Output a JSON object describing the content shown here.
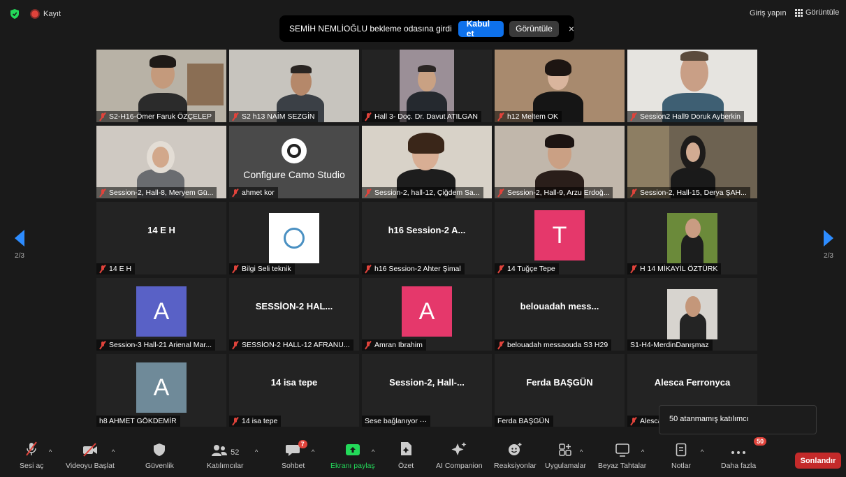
{
  "top": {
    "recording_label": "Kayıt",
    "signin_label": "Giriş yapın",
    "view_label": "Görüntüle"
  },
  "notification": {
    "text": "SEMİH NEMLİOĞLU bekleme odasına girdi",
    "accept_label": "Kabul et",
    "show_label": "Görüntüle",
    "close": "×"
  },
  "pager": {
    "left": "2/3",
    "right": "2/3"
  },
  "tiles": [
    {
      "name": "S2-H16-Ömer Faruk ÖZÇELEP"
    },
    {
      "name": "S2 h13 NAİM SEZGİN"
    },
    {
      "name": "Hall 3- Doç. Dr. Davut ATILGAN"
    },
    {
      "name": "h12 Meltem OK"
    },
    {
      "name": "Session2 Hall9 Doruk Ayberkin"
    },
    {
      "name": "Session-2, Hall-8, Meryem Gü..."
    },
    {
      "name": "ahmet kor",
      "display": "Configure Camo Studio"
    },
    {
      "name": "Session-2, hall-12, Çiğdem Sa..."
    },
    {
      "name": "Session-2, Hall-9, Arzu Erdoğ..."
    },
    {
      "name": "Session-2, Hall-15, Derya ŞAH..."
    },
    {
      "name": "14 E H",
      "display": "14 E H"
    },
    {
      "name": "Bilgi Seli teknik"
    },
    {
      "name": "h16 Session-2 Ahter Şimal",
      "display": "h16 Session-2 A..."
    },
    {
      "name": "14 Tuğçe Tepe",
      "avatar": "T"
    },
    {
      "name": "H 14  MİKAYİL ÖZTÜRK"
    },
    {
      "name": "Session-3 Hall-21 Arienal Mar...",
      "avatar": "A"
    },
    {
      "name": "SESSİON-2 HALL-12 AFRANU...",
      "display": "SESSİON-2  HAL..."
    },
    {
      "name": "Amran Ibrahim",
      "avatar": "A"
    },
    {
      "name": "belouadah messaouda S3  H29",
      "display": "belouadah  mess..."
    },
    {
      "name": "S1-H4-MerdinDanışmaz"
    },
    {
      "name": "h8 AHMET GÖKDEMİR",
      "avatar": "A"
    },
    {
      "name": "14 isa tepe",
      "display": "14 isa tepe"
    },
    {
      "name": "Sese bağlanıyor ···",
      "display": "Session-2,   Hall-..."
    },
    {
      "name": "Ferda BAŞGÜN",
      "display": "Ferda BAŞGÜN"
    },
    {
      "name": "Alesca Ferronyca",
      "display": "Alesca Ferronyca"
    }
  ],
  "tooltip": "50 atanmamış katılımcı",
  "toolbar": {
    "mic": "Sesi aç",
    "video": "Videoyu Başlat",
    "security": "Güvenlik",
    "participants": "Katılımcılar",
    "participants_count": "52",
    "chat": "Sohbet",
    "chat_badge": "7",
    "share": "Ekranı paylaş",
    "summary": "Özet",
    "ai": "AI Companion",
    "reactions": "Reaksiyonlar",
    "apps": "Uygulamalar",
    "whiteboard": "Beyaz Tahtalar",
    "notes": "Notlar",
    "more": "Daha fazla",
    "more_badge": "50",
    "end": "Sonlandır"
  },
  "colors": {
    "accent": "#0e71eb",
    "muted_red": "#e0433b",
    "share_green": "#23d959",
    "end_red": "#c42a2a"
  }
}
